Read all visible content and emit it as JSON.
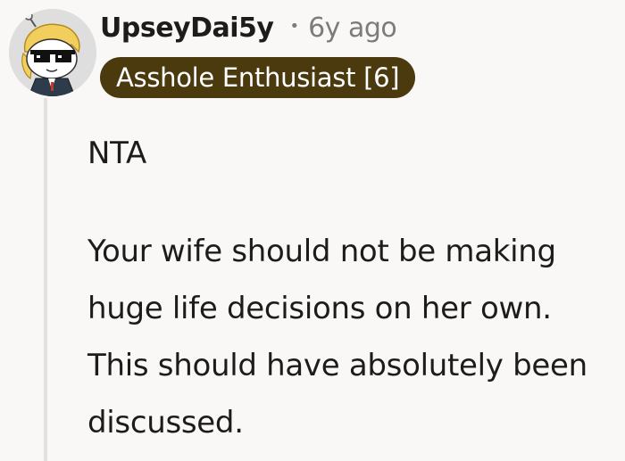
{
  "comment": {
    "username": "UpseyDai5y",
    "separator": "•",
    "age": "6y ago",
    "flair": "Asshole Enthusiast [6]",
    "paragraphs": [
      "NTA",
      "Your wife should not be making huge life decisions on her own. This should have absolutely been discussed."
    ]
  },
  "colors": {
    "background": "#faf8f6",
    "flair_background": "#4a3a0e",
    "flair_text": "#ffffff",
    "meta_text": "#7c7c7c",
    "thread_line": "#e3e1df"
  },
  "icons": {
    "avatar": "snoo-avatar-with-sunglasses"
  }
}
